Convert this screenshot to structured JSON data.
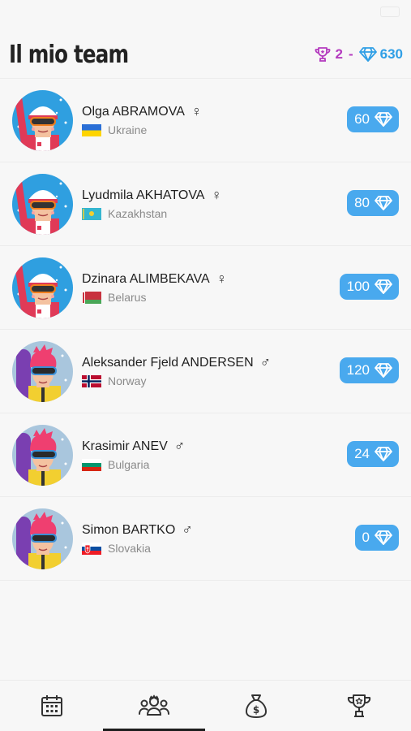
{
  "header": {
    "title": "Il mio team",
    "trophies": "2",
    "separator": "-",
    "gems": "630"
  },
  "athletes": [
    {
      "name": "Olga ABRAMOVA",
      "gender": "♀",
      "country": "Ukraine",
      "value": "60",
      "avatar": "female-skier-avatar"
    },
    {
      "name": "Lyudmila AKHATOVA",
      "gender": "♀",
      "country": "Kazakhstan",
      "value": "80",
      "avatar": "female-skier-avatar"
    },
    {
      "name": "Dzinara ALIMBEKAVA",
      "gender": "♀",
      "country": "Belarus",
      "value": "100",
      "avatar": "female-skier-avatar"
    },
    {
      "name": "Aleksander Fjeld ANDERSEN",
      "gender": "♂",
      "country": "Norway",
      "value": "120",
      "avatar": "male-snowboarder-avatar"
    },
    {
      "name": "Krasimir ANEV",
      "gender": "♂",
      "country": "Bulgaria",
      "value": "24",
      "avatar": "male-snowboarder-avatar"
    },
    {
      "name": "Simon BARTKO",
      "gender": "♂",
      "country": "Slovakia",
      "value": "0",
      "avatar": "male-snowboarder-avatar"
    }
  ],
  "tabs": [
    {
      "icon": "calendar-icon",
      "active": false
    },
    {
      "icon": "team-icon",
      "active": true
    },
    {
      "icon": "money-bag-icon",
      "active": false
    },
    {
      "icon": "trophy-icon",
      "active": false
    }
  ],
  "colors": {
    "accent_blue": "#49a9ee",
    "gem_blue": "#2f9fe6",
    "trophy_purple": "#b43bbf"
  }
}
